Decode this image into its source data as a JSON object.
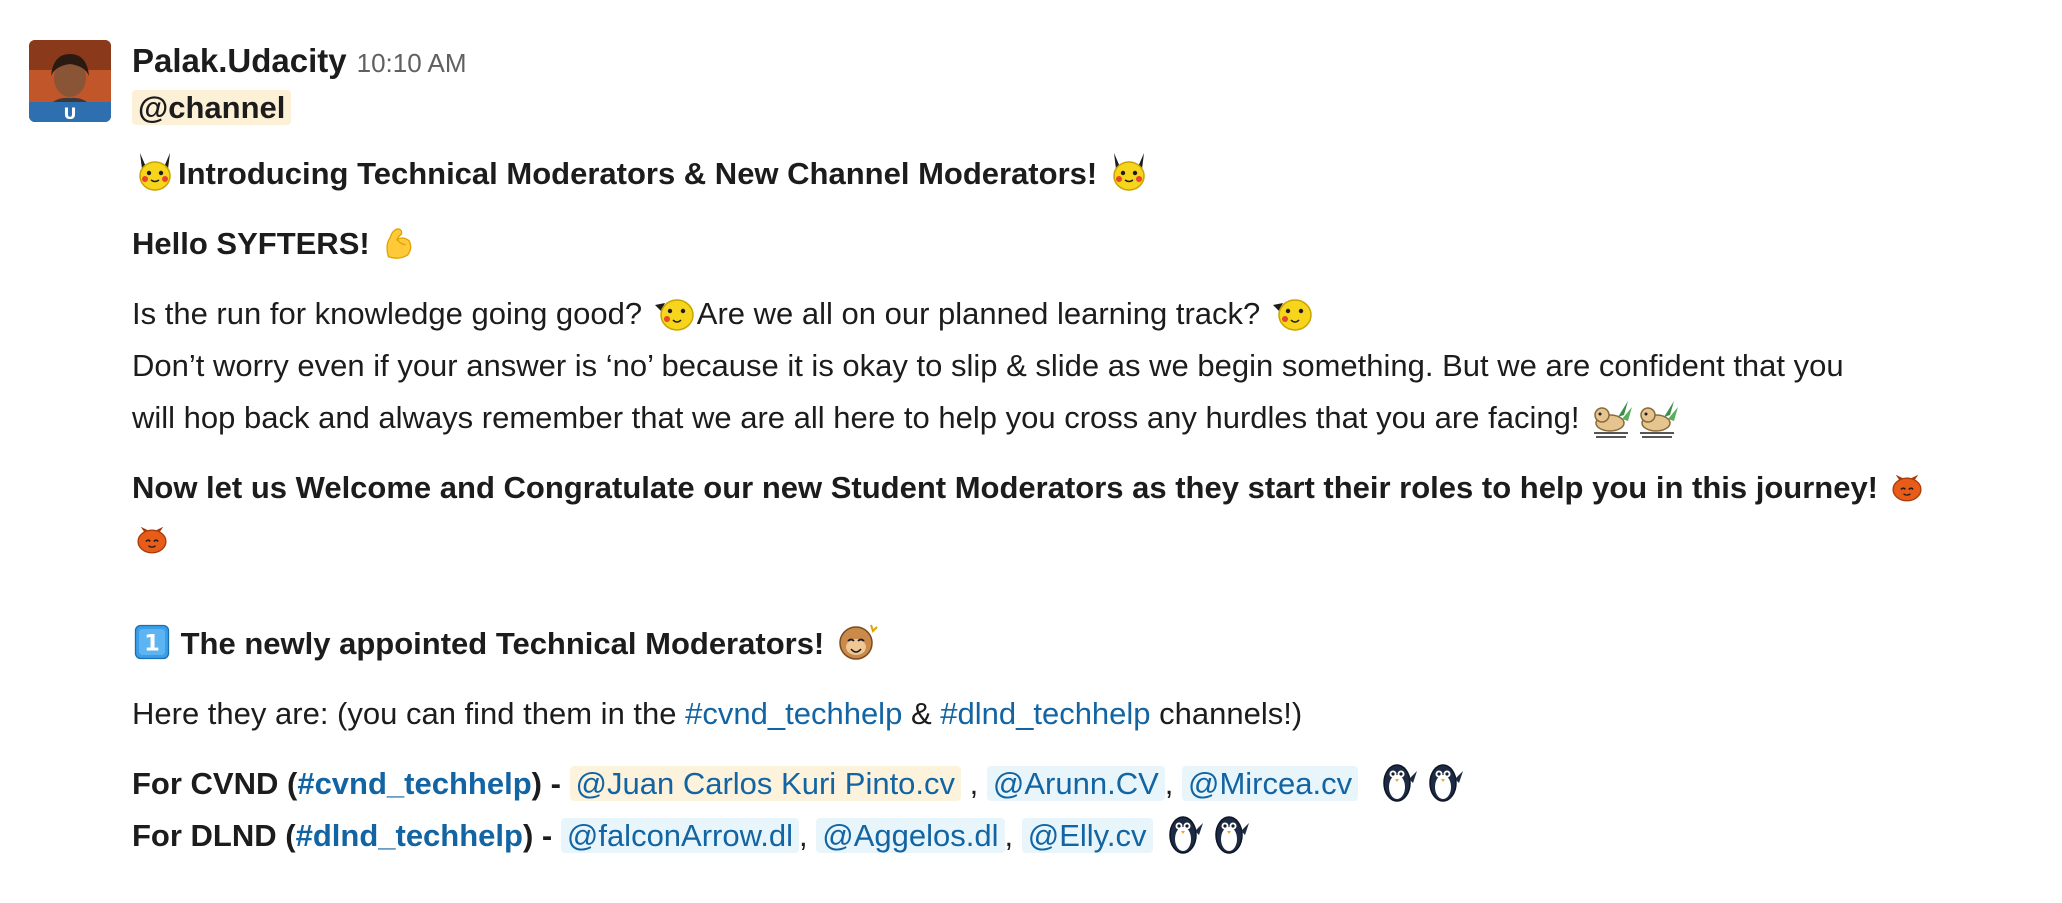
{
  "message": {
    "author": "Palak.Udacity",
    "time": "10:10 AM",
    "channel_mention": "@channel",
    "title": "Introducing Technical Moderators & New Channel Moderators!",
    "greeting": "Hello SYFTERS!",
    "p1_a": "Is the run for knowledge going good?",
    "p1_b": "Are we all on our planned learning track?",
    "p2": "Don’t worry even if your answer is ‘no’ because it is okay to slip & slide as we begin something. But we are confident that you",
    "p3": "will hop back and always remember that we are all here to help you cross any hurdles that you are facing!",
    "welcome": "Now let us Welcome and Congratulate our new Student Moderators as they start their roles to help you in this journey!",
    "section_title": "The newly appointed Technical Moderators!",
    "here_prefix": "Here they are:  (you can find them in the",
    "here_chan1": "#cvnd_techhelp",
    "here_amp": "&",
    "here_chan2": "#dlnd_techhelp",
    "here_suffix": "channels!)",
    "cvnd": {
      "prefix": "For CVND (",
      "channel": "#cvnd_techhelp",
      "suffix": ") -",
      "mentions": [
        "@Juan Carlos Kuri Pinto.cv",
        "@Arunn.CV",
        "@Mircea.cv"
      ]
    },
    "dlnd": {
      "prefix": "For DLND (",
      "channel": "#dlnd_techhelp",
      "suffix": ") -",
      "mentions": [
        "@falconArrow.dl",
        "@Aggelos.dl",
        "@Elly.cv"
      ]
    },
    "emoji_names": [
      "pikachu",
      "muscle",
      "pikachu-face",
      "dancing-dog",
      "pumpkin",
      "keycap-1",
      "monkey-celebrate",
      "penguin"
    ],
    "colors": {
      "link": "#1264a3",
      "mention_yellow_bg": "#fcf0d6",
      "mention_blue_bg": "#e8f5fa",
      "time": "#616061"
    }
  }
}
